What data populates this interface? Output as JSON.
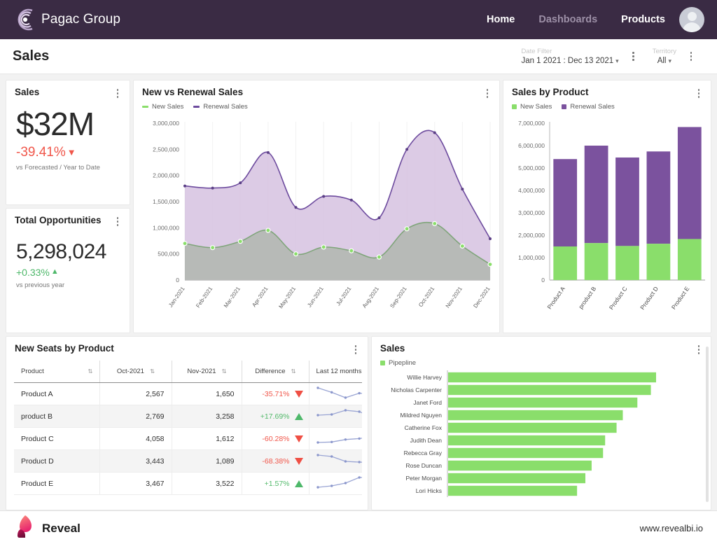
{
  "topnav": {
    "brand": "Pagac Group",
    "brand_logo_icon": "concentric-arcs-logo",
    "links": [
      {
        "label": "Home",
        "active": false
      },
      {
        "label": "Dashboards",
        "active": true
      },
      {
        "label": "Products",
        "active": false
      }
    ],
    "avatar_icon": "user-avatar-icon",
    "bg_color": "#3a2b44",
    "accent_color": "#7b52a0"
  },
  "pagehead": {
    "title": "Sales",
    "date_filter": {
      "label": "Date Filter",
      "value": "Jan 1 2021 : Dec 13 2021"
    },
    "territory_filter": {
      "label": "Territory",
      "value": "All"
    }
  },
  "kpi_sales": {
    "title": "Sales",
    "value": "$32M",
    "delta": "-39.41%",
    "delta_dir": "down",
    "delta_color": "#f0564a",
    "subtitle": "vs Forecasted / Year to Date"
  },
  "kpi_opportunities": {
    "title": "Total Opportunities",
    "value": "5,298,024",
    "delta": "+0.33%",
    "delta_dir": "up",
    "delta_color": "#4eb86a",
    "subtitle": "vs previous year"
  },
  "panel_area": {
    "title": "New vs Renewal Sales"
  },
  "panel_bars": {
    "title": "Sales by Product"
  },
  "panel_table": {
    "title": "New Seats by Product",
    "columns": [
      "Product",
      "Oct-2021",
      "Nov-2021",
      "Difference",
      "Last 12 months"
    ],
    "rows": [
      {
        "product": "Product A",
        "oct": "2,567",
        "nov": "1,650",
        "difference": "-35.71%",
        "dir": "down",
        "spark": [
          62,
          52,
          40,
          50,
          48,
          50,
          52,
          55
        ]
      },
      {
        "product": "product B",
        "oct": "2,769",
        "nov": "3,258",
        "difference": "+17.69%",
        "dir": "up",
        "spark": [
          48,
          50,
          62,
          58,
          42,
          40,
          46,
          34
        ]
      },
      {
        "product": "Product C",
        "oct": "4,058",
        "nov": "1,612",
        "difference": "-60.28%",
        "dir": "down",
        "spark": [
          30,
          32,
          42,
          46,
          54,
          70,
          52,
          50
        ]
      },
      {
        "product": "Product D",
        "oct": "3,443",
        "nov": "1,089",
        "difference": "-68.38%",
        "dir": "down",
        "spark": [
          62,
          58,
          44,
          42,
          40,
          38,
          36,
          34
        ]
      },
      {
        "product": "Product E",
        "oct": "3,467",
        "nov": "3,522",
        "difference": "+1.57%",
        "dir": "up",
        "spark": [
          34,
          36,
          40,
          48,
          48,
          46,
          46,
          44
        ]
      }
    ]
  },
  "panel_sales_people": {
    "title": "Sales"
  },
  "footer": {
    "brand": "Reveal",
    "brand_logo_icon": "reveal-droplet-logo",
    "url": "www.revealbi.io"
  },
  "chart_data": [
    {
      "type": "area",
      "title": "New vs Renewal Sales",
      "x": [
        "Jan-2021",
        "Feb-2021",
        "Mar-2021",
        "Apr-2021",
        "May-2021",
        "Jun-2021",
        "Jul-2021",
        "Aug-2021",
        "Sep-2021",
        "Oct-2021",
        "Nov-2021",
        "Dec-2021"
      ],
      "xlabel": "",
      "ylabel": "",
      "ylim": [
        0,
        3000000
      ],
      "yticks": [
        0,
        500000,
        1000000,
        1500000,
        2000000,
        2500000,
        3000000
      ],
      "ytick_labels": [
        "0",
        "500,000",
        "1,000,000",
        "1,500,000",
        "2,000,000",
        "2,500,000",
        "3,000,000"
      ],
      "grid": false,
      "legend_position": "top-left",
      "stacked": false,
      "series": [
        {
          "name": "New Sales",
          "color": "#8ade6b",
          "line_color": "#7fa57a",
          "fill": "#b7bab7",
          "values": [
            700000,
            620000,
            740000,
            950000,
            500000,
            630000,
            560000,
            440000,
            980000,
            1080000,
            650000,
            300000
          ]
        },
        {
          "name": "Renewal Sales",
          "color": "#6d4b9e",
          "line_color": "#6d4b9e",
          "fill": "#d6c2e0",
          "values": [
            1800000,
            1760000,
            1860000,
            2440000,
            1390000,
            1600000,
            1530000,
            1190000,
            2500000,
            2820000,
            1740000,
            790000
          ]
        }
      ]
    },
    {
      "type": "bar",
      "title": "Sales by Product",
      "categories": [
        "Product A",
        "product B",
        "Product C",
        "Product D",
        "Product E"
      ],
      "xlabel": "",
      "ylabel": "",
      "ylim": [
        0,
        7000000
      ],
      "yticks": [
        0,
        1000000,
        2000000,
        3000000,
        4000000,
        5000000,
        6000000,
        7000000
      ],
      "ytick_labels": [
        "0",
        "1,000,000",
        "2,000,000",
        "3,000,000",
        "4,000,000",
        "5,000,000",
        "6,000,000",
        "7,000,000"
      ],
      "stacked": true,
      "grid": false,
      "legend_position": "top-left",
      "series": [
        {
          "name": "New Sales",
          "color": "#8ade6b",
          "values": [
            1500000,
            1650000,
            1520000,
            1620000,
            1830000
          ]
        },
        {
          "name": "Renewal Sales",
          "color": "#7b529e",
          "values": [
            3900000,
            4350000,
            3950000,
            4120000,
            5000000
          ]
        }
      ]
    },
    {
      "type": "bar",
      "orientation": "horizontal",
      "title": "Sales",
      "legend_position": "top-left",
      "legend_entries": [
        "Pipepline"
      ],
      "categories": [
        "Willie Harvey",
        "Nicholas Carpenter",
        "Janet Ford",
        "Mildred Nguyen",
        "Catherine Fox",
        "Judith Dean",
        "Rebecca Gray",
        "Rose Duncan",
        "Peter Morgan",
        "Lori Hicks"
      ],
      "series": [
        {
          "name": "Pipepline",
          "color": "#8ade6b",
          "values": [
            100,
            97.5,
            91,
            84,
            81,
            75.5,
            74.5,
            69,
            66,
            62
          ]
        }
      ],
      "value_max": 100,
      "grid": false
    }
  ]
}
